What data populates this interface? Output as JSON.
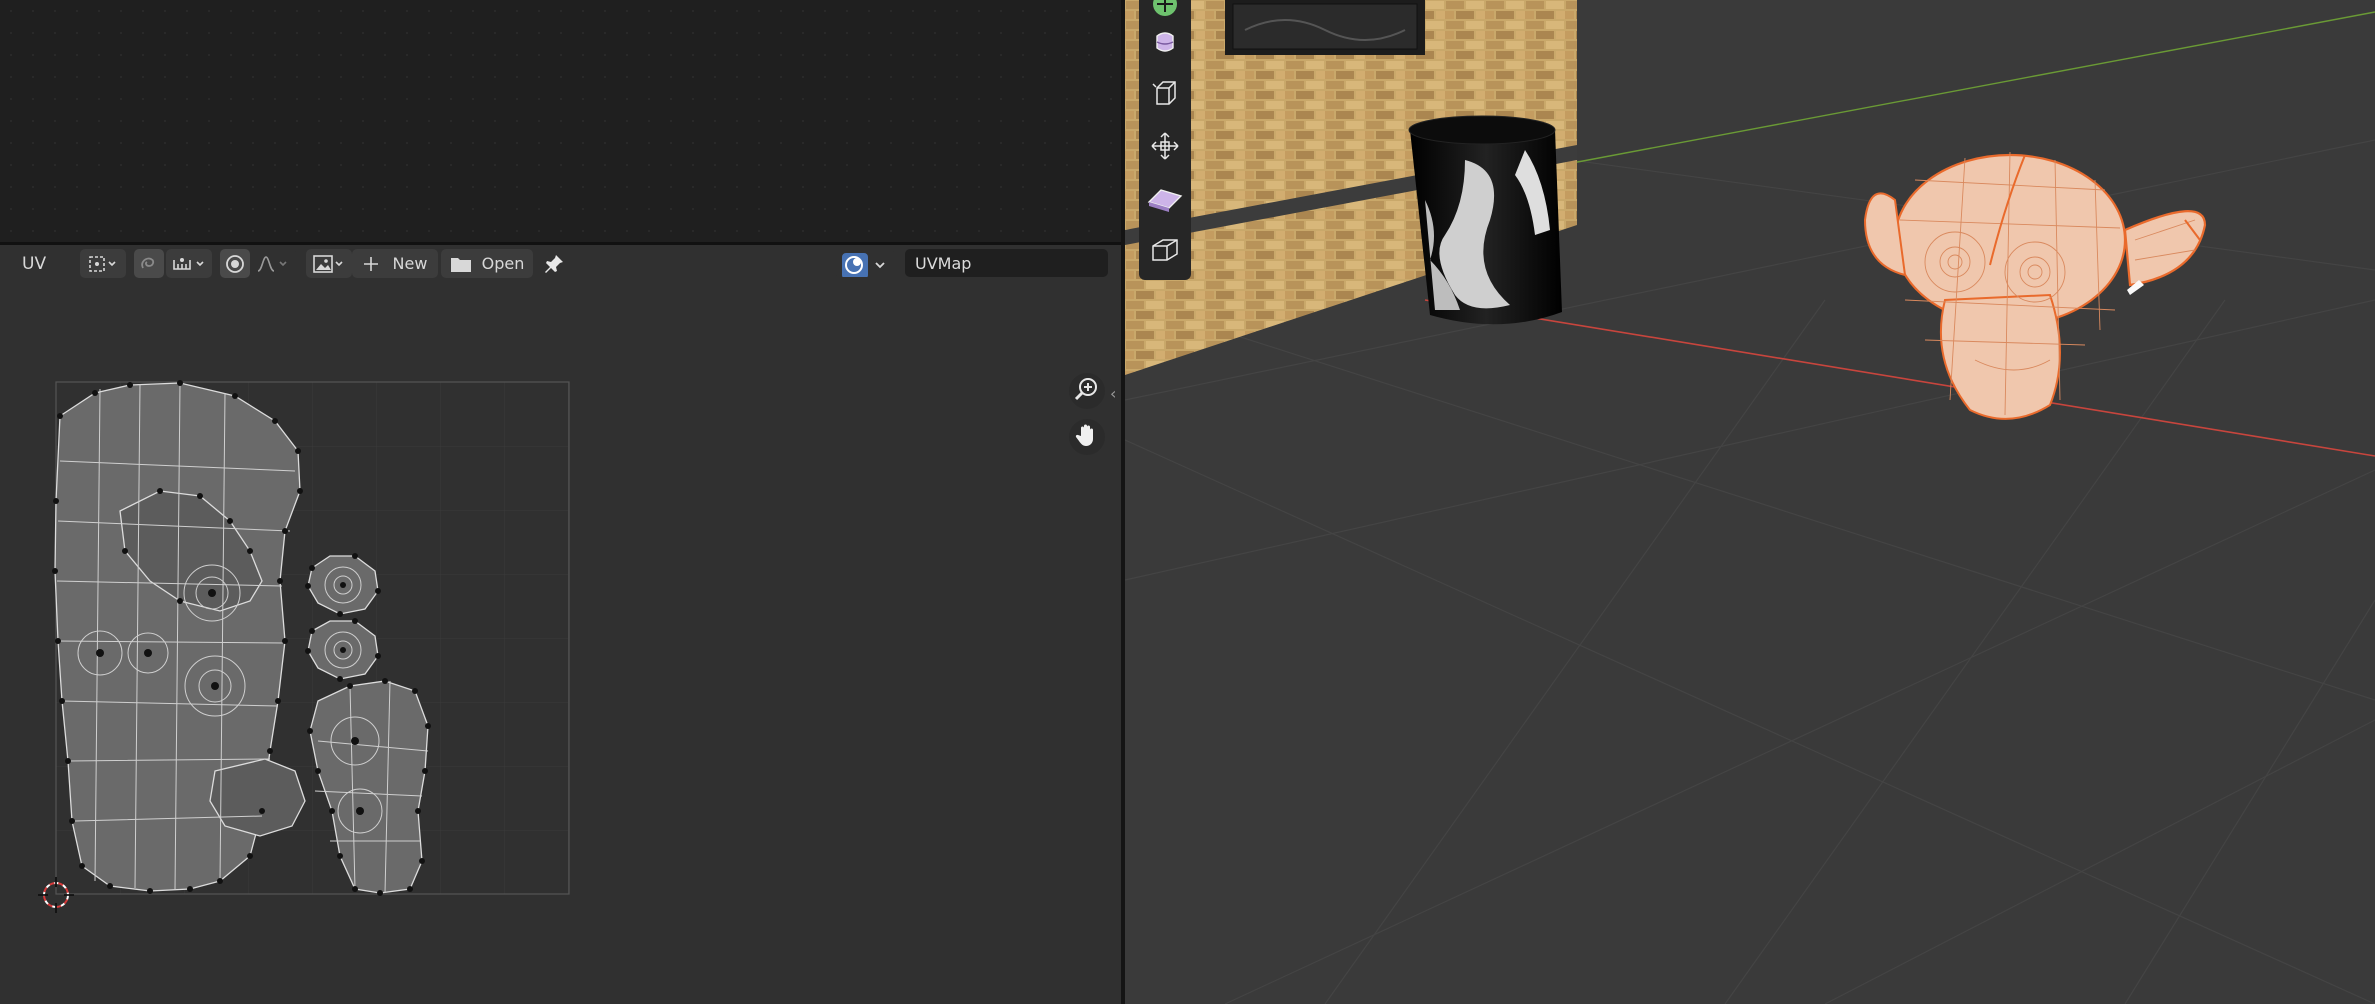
{
  "uv_editor": {
    "mode_label": "UV",
    "new_button_label": "New",
    "open_button_label": "Open",
    "uvmap_name": "UVMap"
  },
  "colors": {
    "selection_accent": "#e96a2c",
    "uv_sync_active": "#4772b3",
    "x_axis": "#c8453d",
    "y_axis": "#6a9a35"
  },
  "icons": {
    "header": [
      "pivot-icon",
      "sticky-select-icon",
      "snapping-icon",
      "proportional-editing-icon",
      "falloff-icon",
      "image-browse-icon",
      "plus-icon",
      "folder-icon",
      "pin-icon",
      "uv-sync-selection-icon"
    ],
    "navigation": [
      "zoom-icon",
      "pan-hand-icon"
    ],
    "toolbar": [
      "cursor-tool-icon",
      "move-tool-icon",
      "rotate-tool-icon",
      "scale-tool-icon",
      "transform-tool-icon",
      "annotate-tool-icon",
      "measure-tool-icon",
      "add-cube-icon"
    ]
  }
}
